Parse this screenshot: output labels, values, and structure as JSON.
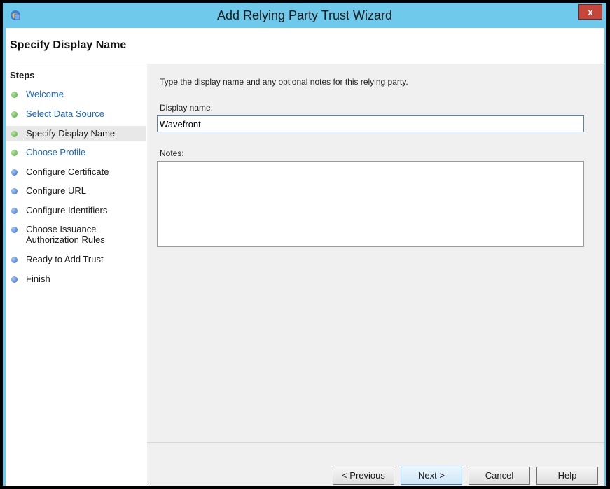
{
  "window": {
    "title": "Add Relying Party Trust Wizard",
    "close_label": "x"
  },
  "header": {
    "title": "Specify Display Name"
  },
  "steps": {
    "heading": "Steps",
    "items": [
      {
        "label": "Welcome",
        "state": "done"
      },
      {
        "label": "Select Data Source",
        "state": "done"
      },
      {
        "label": "Specify Display Name",
        "state": "current"
      },
      {
        "label": "Choose Profile",
        "state": "done"
      },
      {
        "label": "Configure Certificate",
        "state": "pending"
      },
      {
        "label": "Configure URL",
        "state": "pending"
      },
      {
        "label": "Configure Identifiers",
        "state": "pending"
      },
      {
        "label": "Choose Issuance Authorization Rules",
        "state": "pending"
      },
      {
        "label": "Ready to Add Trust",
        "state": "pending"
      },
      {
        "label": "Finish",
        "state": "pending"
      }
    ]
  },
  "main": {
    "instruction": "Type the display name and any optional notes for this relying party.",
    "display_name_label": "Display name:",
    "display_name_value": "Wavefront",
    "notes_label": "Notes:",
    "notes_value": ""
  },
  "footer": {
    "previous_label": "< Previous",
    "next_label": "Next >",
    "cancel_label": "Cancel",
    "help_label": "Help"
  },
  "colors": {
    "titlebar": "#6fc9ea",
    "link": "#1a67c9",
    "close": "#c7463b"
  }
}
